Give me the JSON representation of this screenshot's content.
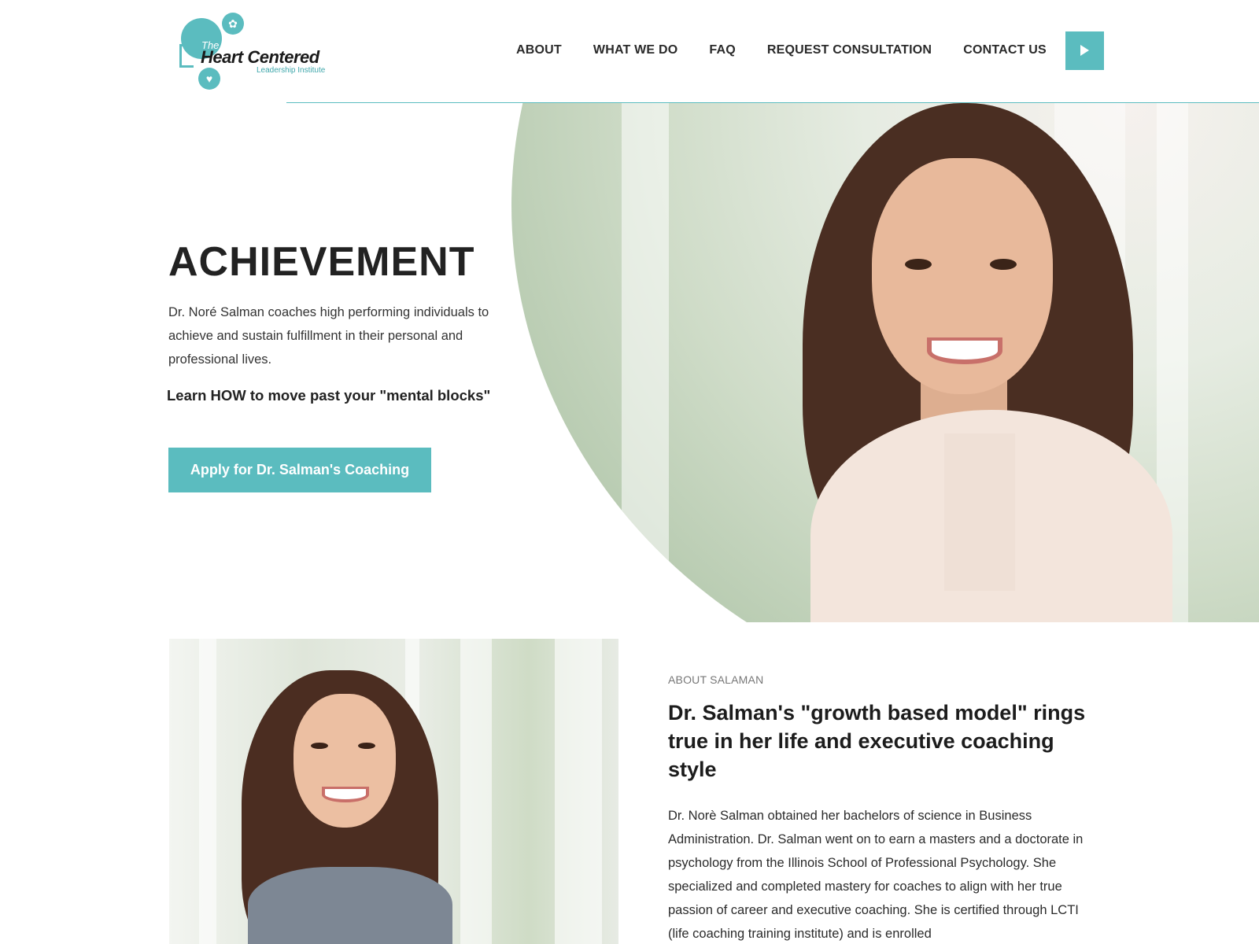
{
  "header": {
    "logo": {
      "the": "The",
      "name": "Heart Centered",
      "sub": "Leadership Institute"
    },
    "nav": [
      {
        "label": "ABOUT"
      },
      {
        "label": "WHAT WE DO"
      },
      {
        "label": "FAQ"
      },
      {
        "label": "REQUEST CONSULTATION"
      },
      {
        "label": "CONTACT US"
      }
    ],
    "play_icon": "play-icon"
  },
  "hero": {
    "title": "ACHIEVEMENT",
    "description": "Dr. Noré Salman coaches high performing individuals to achieve and sustain fulfillment in their personal and professional lives.",
    "learn": "Learn HOW to move past your \"mental blocks\"",
    "cta_label": "Apply for Dr. Salman's Coaching"
  },
  "about": {
    "eyebrow": "ABOUT SALAMAN",
    "heading": "Dr. Salman's \"growth based model\" rings true in her life and executive coaching style",
    "body": "Dr. Norè Salman obtained her bachelors of science in Business Administration.  Dr. Salman went on to earn a masters and a doctorate in psychology from the Illinois School of Professional Psychology. She specialized and completed mastery for coaches to align with her true passion of career and executive coaching. She is certified through LCTI (life coaching training institute) and is enrolled"
  },
  "colors": {
    "accent": "#5bbcbf",
    "text": "#222222"
  }
}
